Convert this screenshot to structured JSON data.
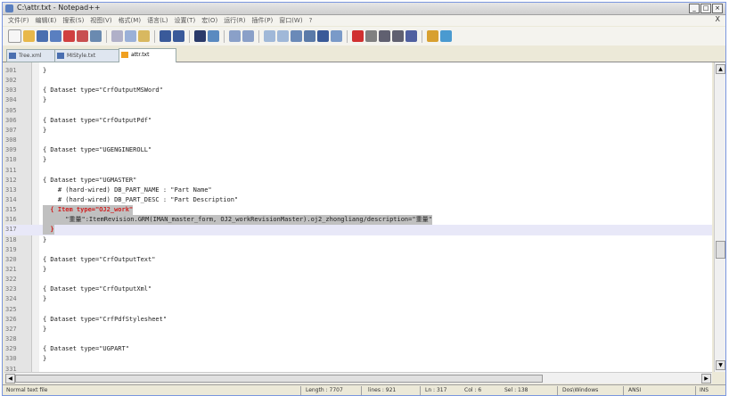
{
  "window": {
    "title": "C:\\attr.txt - Notepad++",
    "min_label": "_",
    "max_label": "□",
    "close_label": "×"
  },
  "menu": {
    "items": [
      "文件(F)",
      "编辑(E)",
      "搜索(S)",
      "视图(V)",
      "格式(M)",
      "语言(L)",
      "设置(T)",
      "宏(O)",
      "运行(R)",
      "插件(P)",
      "窗口(W)",
      "?"
    ],
    "close_label": "X"
  },
  "tabs": [
    {
      "label": "Tree.xml"
    },
    {
      "label": "MIStyle.txt"
    },
    {
      "label": "attr.txt"
    }
  ],
  "editor": {
    "lines": [
      {
        "num": "301",
        "text": "}"
      },
      {
        "num": "302",
        "text": ""
      },
      {
        "num": "303",
        "text": "{ Dataset type=\"CrfOutputMSWord\""
      },
      {
        "num": "304",
        "text": "}"
      },
      {
        "num": "305",
        "text": ""
      },
      {
        "num": "306",
        "text": "{ Dataset type=\"CrfOutputPdf\""
      },
      {
        "num": "307",
        "text": "}"
      },
      {
        "num": "308",
        "text": ""
      },
      {
        "num": "309",
        "text": "{ Dataset type=\"UGENGINEROLL\""
      },
      {
        "num": "310",
        "text": "}"
      },
      {
        "num": "311",
        "text": ""
      },
      {
        "num": "312",
        "text": "{ Dataset type=\"UGMASTER\""
      },
      {
        "num": "313",
        "text": "    # (hard-wired) DB_PART_NAME : \"Part Name\""
      },
      {
        "num": "314",
        "text": "    # (hard-wired) DB_PART_DESC : \"Part Description\""
      },
      {
        "num": "315",
        "text": "  { Item type=\"OJ2_work\""
      },
      {
        "num": "316",
        "text": "      \"重量\":ItemRevision.GRM(IMAN_master_form, OJ2_workRevisionMaster).oj2_zhongliang/description=\"重量\""
      },
      {
        "num": "317",
        "text": "  }"
      },
      {
        "num": "318",
        "text": "}"
      },
      {
        "num": "319",
        "text": ""
      },
      {
        "num": "320",
        "text": "{ Dataset type=\"CrfOutputText\""
      },
      {
        "num": "321",
        "text": "}"
      },
      {
        "num": "322",
        "text": ""
      },
      {
        "num": "323",
        "text": "{ Dataset type=\"CrfOutputXml\""
      },
      {
        "num": "324",
        "text": "}"
      },
      {
        "num": "325",
        "text": ""
      },
      {
        "num": "326",
        "text": "{ Dataset type=\"CrfPdfStylesheet\""
      },
      {
        "num": "327",
        "text": "}"
      },
      {
        "num": "328",
        "text": ""
      },
      {
        "num": "329",
        "text": "{ Dataset type=\"UGPART\""
      },
      {
        "num": "330",
        "text": "}"
      },
      {
        "num": "331",
        "text": ""
      }
    ]
  },
  "status": {
    "filetype": "Normal text file",
    "length": "Length : 7707",
    "lines": "lines : 921",
    "ln": "Ln : 317",
    "col": "Col : 6",
    "sel": "Sel : 138",
    "eol": "Dos\\Windows",
    "encoding": "ANSI",
    "ins": "INS"
  },
  "colors": {
    "accent": "#d02020",
    "selection": "#c0c0c0",
    "current_line": "#e8e8f8"
  }
}
